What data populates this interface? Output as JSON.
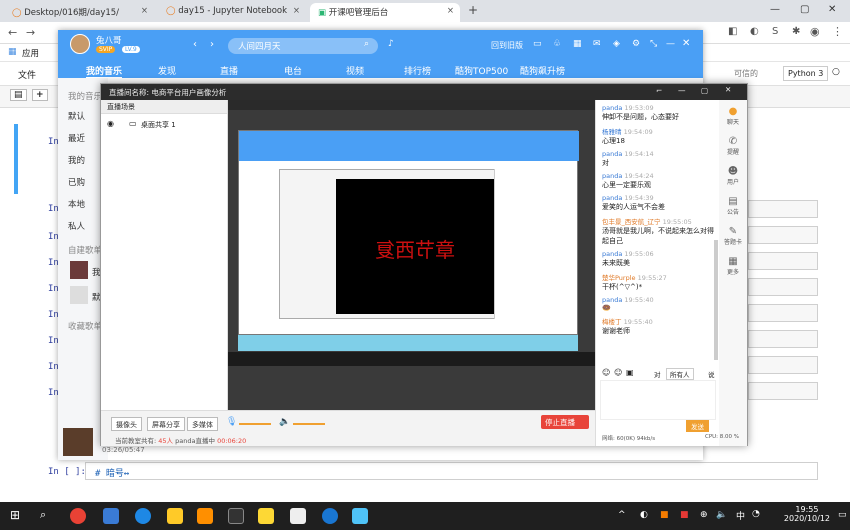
{
  "browser": {
    "tabs": [
      {
        "label": "Desktop/016期/day15/"
      },
      {
        "label": "day15 - Jupyter Notebook"
      },
      {
        "label": "开课吧管理后台"
      }
    ],
    "new_tab": "+",
    "bookmarks_label": "应用"
  },
  "jupyter": {
    "menu": [
      "文件"
    ],
    "kernel": "Python 3",
    "trusted": "可信的",
    "cell_prompts": [
      "In",
      "In",
      "In",
      "In",
      "In",
      "In",
      "In",
      "In",
      "In"
    ],
    "last_cell_prompt": "In [ ]:",
    "last_cell_code": "# 暗号↔"
  },
  "music": {
    "user": "兔八哥",
    "vip": "SVIP",
    "level": "LV.9",
    "search": "人间四月天",
    "back_to_old": "回到旧版",
    "nav": [
      "我的音乐",
      "发现",
      "直播",
      "电台",
      "视频",
      "排行榜",
      "酷狗TOP500",
      "酷狗飙升榜"
    ],
    "sidebar": [
      "我的音乐",
      "默认",
      "最近",
      "我的",
      "已购",
      "本地",
      "私人"
    ],
    "sidebar_section": "自建歌单",
    "sidebar_playlists": [
      "我",
      "默认"
    ],
    "sidebar_section2": "收藏歌单",
    "player_time": "03:26/05:47"
  },
  "live": {
    "title": "直播间名称: 电商平台用户画像分析",
    "scene_header": "直播场景",
    "scene_item": "桌面共享 1",
    "inner_red_text": "章节西复",
    "buttons": [
      "摄像头",
      "屏幕分享",
      "多媒体"
    ],
    "stop_btn": "停止直播",
    "status_prefix": "当前教室共有:",
    "status_count": "45人",
    "status_host": "panda直播中",
    "status_time": "00:06:20",
    "chat": [
      {
        "name": "panda",
        "time": "19:53:09",
        "msg": "伸卸不是问题，心态要好",
        "orange": false
      },
      {
        "name": "杨雅晴",
        "time": "19:54:09",
        "msg": "心理18",
        "orange": false
      },
      {
        "name": "panda",
        "time": "19:54:14",
        "msg": "对",
        "orange": false
      },
      {
        "name": "panda",
        "time": "19:54:24",
        "msg": "心里一定要乐观",
        "orange": false
      },
      {
        "name": "panda",
        "time": "19:54:39",
        "msg": "爱笑的人运气不会差",
        "orange": false
      },
      {
        "name": "包丰景_西安航_辽宁",
        "time": "19:55:05",
        "msg": "汤哥就是我儿啊，不说起来怎么对得起自己",
        "orange": true
      },
      {
        "name": "panda",
        "time": "19:55:06",
        "msg": "未来既美",
        "orange": false
      },
      {
        "name": "楚华Purple",
        "time": "19:55:27",
        "msg": "干杯(^▽^)*",
        "orange": true
      },
      {
        "name": "panda",
        "time": "19:55:40",
        "msg": "🍩",
        "orange": false
      },
      {
        "name": "梅楼丁",
        "time": "19:55:40",
        "msg": "谢谢老师",
        "orange": true
      }
    ],
    "chat_target_label": "对",
    "chat_target": "所有人",
    "chat_say": "说",
    "send": "发送",
    "net_status": "网络: 60(0K) 94kb/s",
    "cpu_status": "CPU: 8.00 %",
    "right_tools": [
      "聊天",
      "提醒",
      "用户",
      "公告",
      "答题卡",
      "更多"
    ]
  },
  "taskbar": {
    "time": "19:55",
    "date": "2020/10/12",
    "ime": "中"
  }
}
